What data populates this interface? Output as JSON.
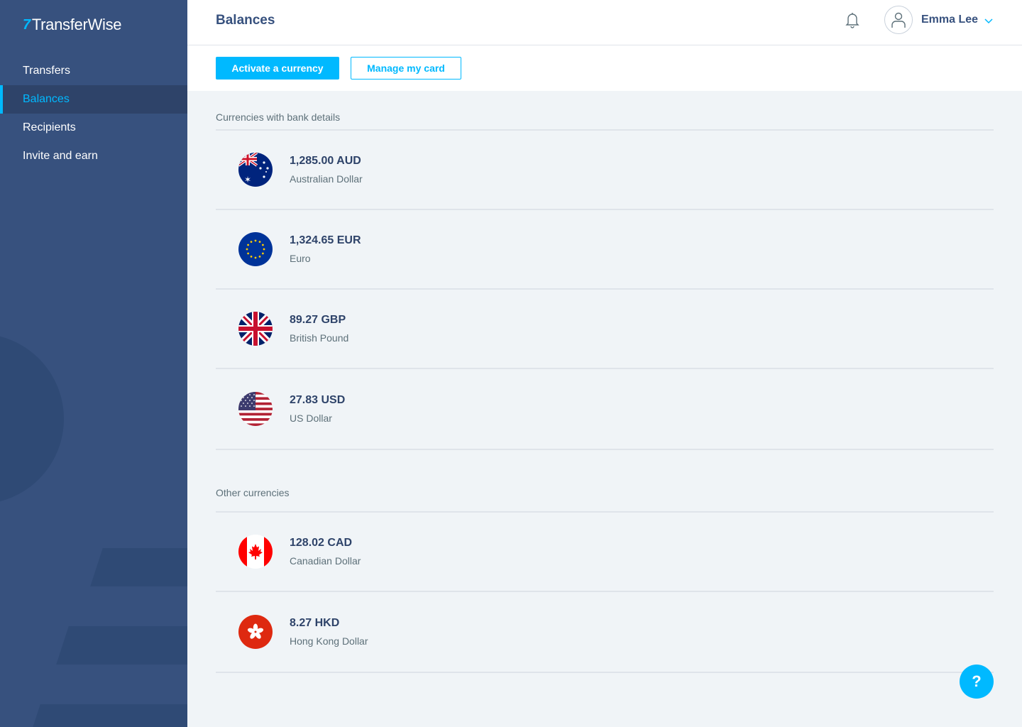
{
  "app": {
    "logo_mark": "7",
    "logo_text": "TransferWise"
  },
  "sidebar": {
    "items": [
      {
        "label": "Transfers",
        "active": false
      },
      {
        "label": "Balances",
        "active": true
      },
      {
        "label": "Recipients",
        "active": false
      },
      {
        "label": "Invite and earn",
        "active": false
      }
    ]
  },
  "header": {
    "title": "Balances",
    "notifications_icon": "bell-icon",
    "user_name": "Emma Lee",
    "user_menu_icon": "chevron-down-icon"
  },
  "toolbar": {
    "activate_label": "Activate a currency",
    "manage_label": "Manage my card"
  },
  "sections": {
    "bank_details_title": "Currencies with bank details",
    "other_title": "Other currencies"
  },
  "balances_with_bank_details": [
    {
      "amount": "1,285.00 AUD",
      "name": "Australian Dollar",
      "flag": "australia-flag-icon"
    },
    {
      "amount": "1,324.65 EUR",
      "name": "Euro",
      "flag": "eu-flag-icon"
    },
    {
      "amount": "89.27 GBP",
      "name": "British Pound",
      "flag": "uk-flag-icon"
    },
    {
      "amount": "27.83 USD",
      "name": "US Dollar",
      "flag": "us-flag-icon"
    }
  ],
  "other_balances": [
    {
      "amount": "128.02 CAD",
      "name": "Canadian Dollar",
      "flag": "canada-flag-icon"
    },
    {
      "amount": "8.27 HKD",
      "name": "Hong Kong Dollar",
      "flag": "hong-kong-flag-icon"
    }
  ],
  "help": {
    "label": "?"
  },
  "colors": {
    "sidebar_bg": "#37517e",
    "accent": "#00b9ff",
    "text_dark": "#2e4369",
    "text_muted": "#5d7079",
    "content_bg": "#f0f4f7"
  }
}
